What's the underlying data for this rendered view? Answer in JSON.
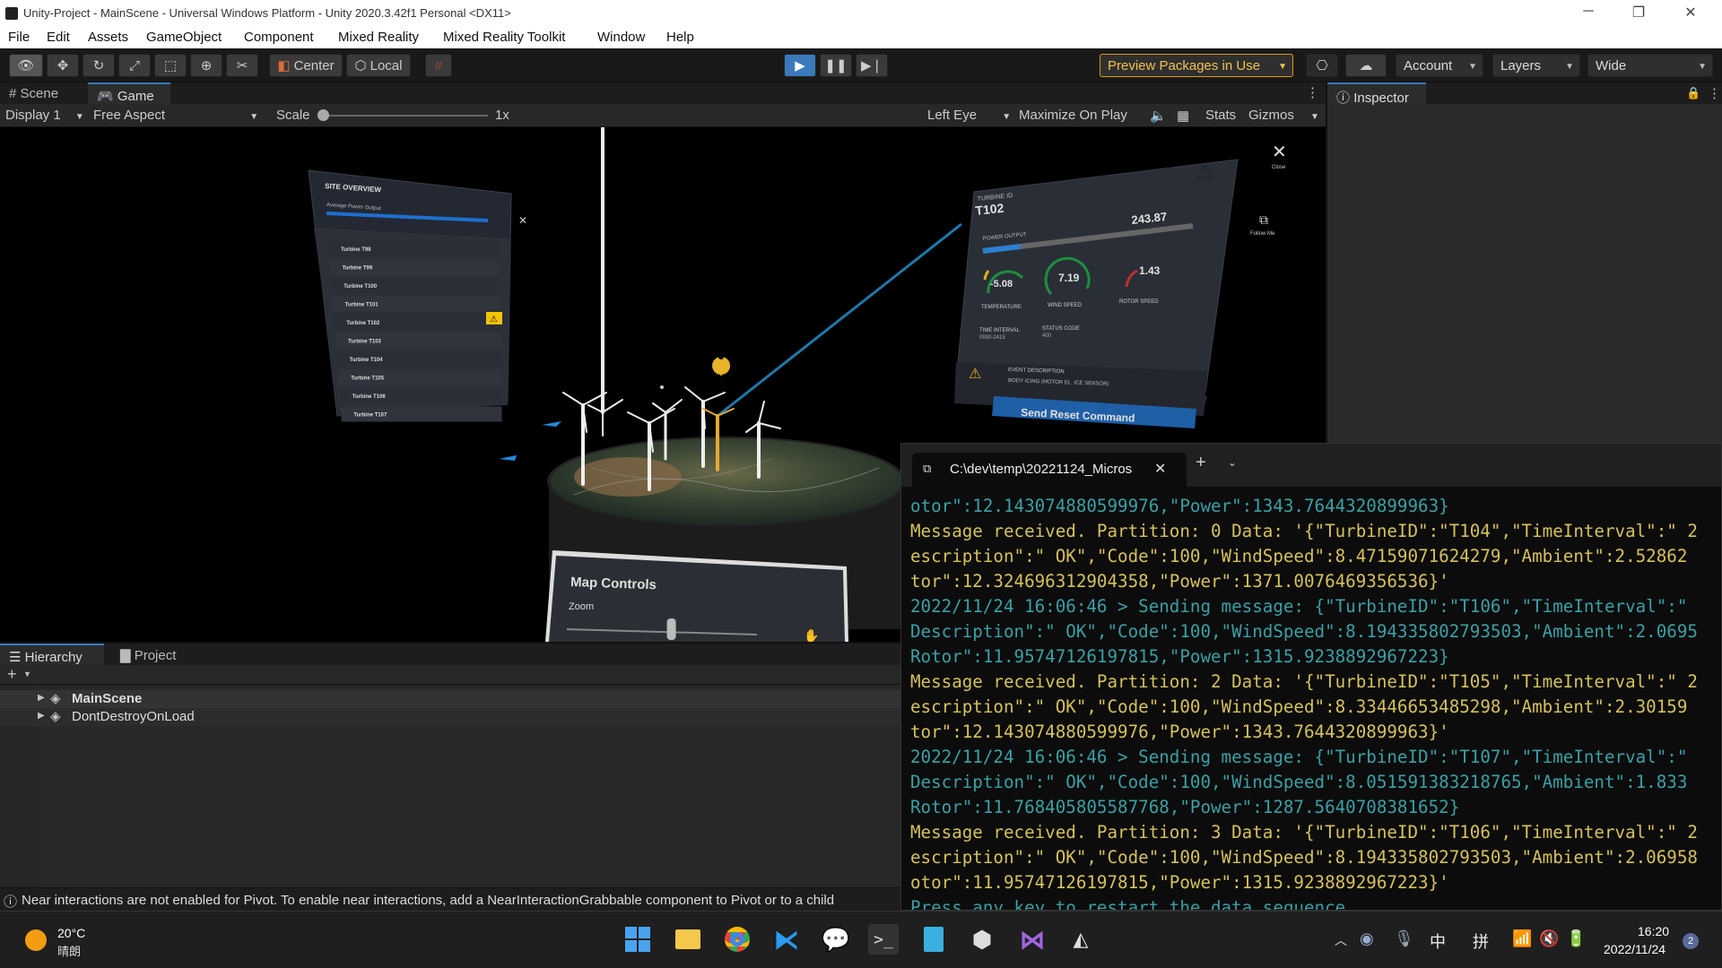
{
  "window": {
    "title": "Unity-Project - MainScene - Universal Windows Platform - Unity 2020.3.42f1 Personal <DX11>"
  },
  "menu": [
    "File",
    "Edit",
    "Assets",
    "GameObject",
    "Component",
    "Mixed Reality",
    "Mixed Reality Toolkit",
    "Window",
    "Help"
  ],
  "toolbar": {
    "center_label": "Center",
    "local_label": "Local",
    "preview_packages": "Preview Packages in Use",
    "account": "Account",
    "layers": "Layers",
    "layout": "Wide"
  },
  "view_tabs": {
    "scene": "Scene",
    "game": "Game"
  },
  "gamebar": {
    "display": "Display 1",
    "aspect": "Free Aspect",
    "scale_label": "Scale",
    "scale_value": 0.0,
    "scale_text": "1x",
    "eye": "Left Eye",
    "maximize": "Maximize On Play",
    "stats": "Stats",
    "gizmos": "Gizmos"
  },
  "inspector": {
    "title": "Inspector"
  },
  "site_overview": {
    "title": "SITE OVERVIEW",
    "subtitle": "Average Power Output",
    "turbines": [
      "Turbine T98",
      "Turbine T99",
      "Turbine T100",
      "Turbine T101",
      "Turbine T102",
      "Turbine T103",
      "Turbine T104",
      "Turbine T105",
      "Turbine T106",
      "Turbine T107"
    ]
  },
  "turbine_panel": {
    "id_label": "TURBINE ID",
    "id": "T102",
    "power_label": "POWER OUTPUT",
    "power": "243.87",
    "temperature": "-5.08",
    "wind_speed": "7.19",
    "rotor_speed": "1.43",
    "temperature_label": "TEMPERATURE",
    "wind_speed_label": "WIND SPEED",
    "rotor_speed_label": "ROTOR SPEED",
    "time_interval_label": "TIME INTERVAL",
    "time_interval": "0930-2415",
    "status_code_label": "STATUS CODE",
    "status_code": "400",
    "event_label": "EVENT DESCRIPTION",
    "event": "BODY ICING (MOTOR EL. ICE SENSOR)",
    "reset_button": "Send Reset Command",
    "close_label": "Close",
    "follow_label": "Follow Me"
  },
  "map_controls": {
    "title": "Map Controls",
    "zoom_label": "Zoom",
    "zoom_value": 0.55
  },
  "hierarchy": {
    "tab": "Hierarchy",
    "project_tab": "Project",
    "items": [
      "MainScene",
      "DontDestroyOnLoad"
    ]
  },
  "status": {
    "message": "Near interactions are not enabled for Pivot. To enable near interactions, add a NearInteractionGrabbable component to Pivot or to a child"
  },
  "terminal": {
    "tab_title": "C:\\dev\\temp\\20221124_Micros",
    "lines": [
      {
        "text": "otor\":12.143074880599976,\"Power\":1343.7644320899963}",
        "color": "#3aa0a6"
      },
      {
        "text": "Message received. Partition: 0 Data: '{\"TurbineID\":\"T104\",\"TimeInterval\":\" 2",
        "color": "#d6c15c"
      },
      {
        "text": "escription\":\" OK\",\"Code\":100,\"WindSpeed\":8.47159071624279,\"Ambient\":2.52862",
        "color": "#d6c15c"
      },
      {
        "text": "tor\":12.324696312904358,\"Power\":1371.0076469356536}'",
        "color": "#d6c15c"
      },
      {
        "text": "2022/11/24 16:06:46 > Sending message: {\"TurbineID\":\"T106\",\"TimeInterval\":\"",
        "color": "#3aa0a6"
      },
      {
        "text": "Description\":\" OK\",\"Code\":100,\"WindSpeed\":8.194335802793503,\"Ambient\":2.0695",
        "color": "#3aa0a6"
      },
      {
        "text": "Rotor\":11.95747126197815,\"Power\":1315.9238892967223}",
        "color": "#3aa0a6"
      },
      {
        "text": "Message received. Partition: 2 Data: '{\"TurbineID\":\"T105\",\"TimeInterval\":\" 2",
        "color": "#d6c15c"
      },
      {
        "text": "escription\":\" OK\",\"Code\":100,\"WindSpeed\":8.33446653485298,\"Ambient\":2.30159",
        "color": "#d6c15c"
      },
      {
        "text": "tor\":12.143074880599976,\"Power\":1343.7644320899963}'",
        "color": "#d6c15c"
      },
      {
        "text": "2022/11/24 16:06:46 > Sending message: {\"TurbineID\":\"T107\",\"TimeInterval\":\"",
        "color": "#3aa0a6"
      },
      {
        "text": "Description\":\" OK\",\"Code\":100,\"WindSpeed\":8.051591383218765,\"Ambient\":1.833",
        "color": "#3aa0a6"
      },
      {
        "text": "Rotor\":11.768405805587768,\"Power\":1287.5640708381652}",
        "color": "#3aa0a6"
      },
      {
        "text": "Message received. Partition: 3 Data: '{\"TurbineID\":\"T106\",\"TimeInterval\":\" 2",
        "color": "#d6c15c"
      },
      {
        "text": "escription\":\" OK\",\"Code\":100,\"WindSpeed\":8.194335802793503,\"Ambient\":2.06958",
        "color": "#d6c15c"
      },
      {
        "text": "otor\":11.95747126197815,\"Power\":1315.9238892967223}'",
        "color": "#d6c15c"
      },
      {
        "text": "Press any key to restart the data sequence.",
        "color": "#3aa0a6"
      }
    ]
  },
  "taskbar": {
    "weather_temp": "20°C",
    "weather_desc": "晴朗",
    "ime": "中",
    "ime2": "拼",
    "time": "16:20",
    "date": "2022/11/24",
    "notification_count": "2"
  },
  "colors": {
    "accent": "#3a79bb",
    "warning": "#f5c400",
    "panel": "#2c3038",
    "reset_button": "#1e5fa6"
  }
}
